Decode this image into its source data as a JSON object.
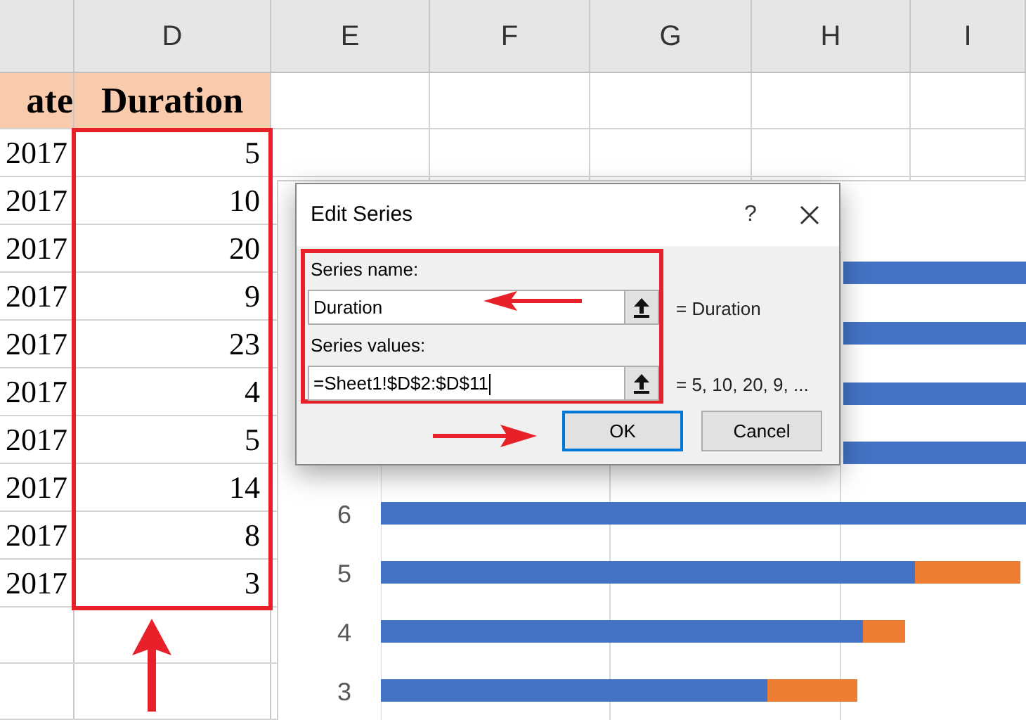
{
  "column_headers": [
    "D",
    "E",
    "F",
    "G",
    "H",
    "I"
  ],
  "header_row": [
    "ate",
    "Duration"
  ],
  "rows": [
    [
      "2017",
      "5"
    ],
    [
      "2017",
      "10"
    ],
    [
      "2017",
      "20"
    ],
    [
      "2017",
      "9"
    ],
    [
      "2017",
      "23"
    ],
    [
      "2017",
      "4"
    ],
    [
      "2017",
      "5"
    ],
    [
      "2017",
      "14"
    ],
    [
      "2017",
      "8"
    ],
    [
      "2017",
      "3"
    ]
  ],
  "chart": {
    "category_labels": [
      "6",
      "5",
      "4",
      "3"
    ]
  },
  "dialog": {
    "title": "Edit Series",
    "help": "?",
    "name_label": "Series name:",
    "name_value": "Duration",
    "name_preview": "= Duration",
    "values_label": "Series values:",
    "values_value": "=Sheet1!$D$2:$D$11",
    "values_preview": "= 5, 10, 20, 9, ...",
    "buttons": [
      {
        "label": "OK",
        "default": true
      },
      {
        "label": "Cancel",
        "default": false
      }
    ]
  }
}
